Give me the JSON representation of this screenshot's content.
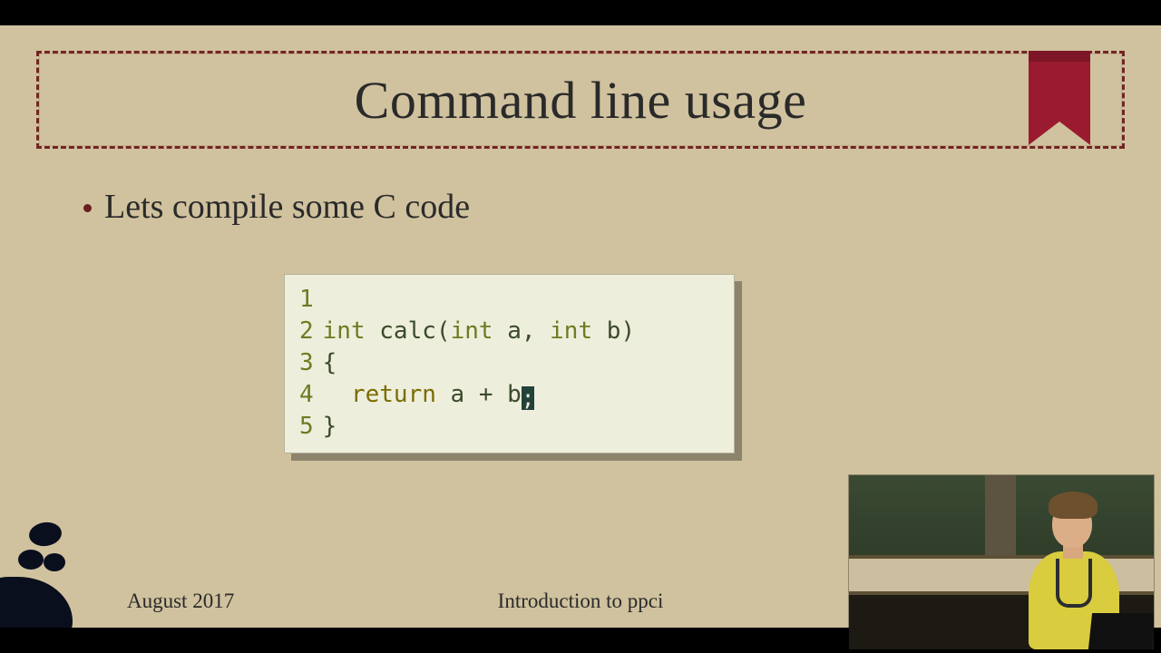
{
  "slide": {
    "title": "Command line usage",
    "bullet": "Lets compile some C code",
    "footer_date": "August 2017",
    "footer_title": "Introduction to ppci"
  },
  "code": {
    "lines": {
      "n1": "1",
      "n2": "2",
      "n3": "3",
      "n4": "4",
      "n5": "5"
    },
    "l2_type1": "int",
    "l2_fn": "calc",
    "l2_open": "(",
    "l2_type2": "int",
    "l2_a": "a",
    "l2_comma": ",",
    "l2_type3": "int",
    "l2_b": "b",
    "l2_close": ")",
    "l3_brace": "{",
    "l4_return": "return",
    "l4_a": "a",
    "l4_plus": "+",
    "l4_b": "b",
    "l4_semi": ";",
    "l5_brace": "}"
  },
  "colors": {
    "ribbon": "#9a1b2f",
    "border": "#732424"
  }
}
